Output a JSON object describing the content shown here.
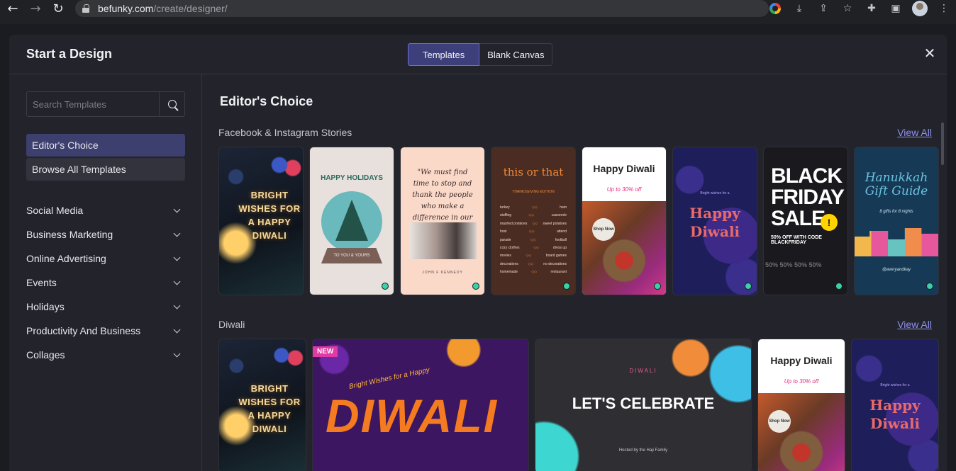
{
  "browser": {
    "url_host": "befunky.com",
    "url_path": "/create/designer/",
    "icons": [
      "back-arrow-icon",
      "forward-arrow-icon",
      "reload-icon",
      "lock-icon",
      "google-icon",
      "download-icon",
      "share-icon",
      "star-icon",
      "extensions-icon",
      "sidebar-icon",
      "profile-avatar",
      "menu-icon"
    ]
  },
  "modal": {
    "title": "Start a Design",
    "tabs": [
      "Templates",
      "Blank Canvas"
    ],
    "active_tab": "Templates",
    "accent": "#3d3f7a"
  },
  "sidebar": {
    "search_placeholder": "Search Templates",
    "primary": [
      {
        "label": "Editor's Choice",
        "selected": true
      },
      {
        "label": "Browse All Templates",
        "selected": false
      }
    ],
    "categories": [
      "Social Media",
      "Business Marketing",
      "Online Advertising",
      "Events",
      "Holidays",
      "Productivity And Business",
      "Collages"
    ]
  },
  "main": {
    "title": "Editor's Choice",
    "view_all": "View All",
    "sections": [
      {
        "label": "Facebook & Instagram Stories",
        "templates": [
          {
            "name": "bright-wishes-diwali",
            "text": "BRIGHT WISHES FOR A HAPPY DIWALI"
          },
          {
            "name": "happy-holidays",
            "text": "HAPPY HOLIDAYS",
            "sub": "TO YOU & YOURS",
            "premium": true
          },
          {
            "name": "kennedy-quote",
            "text": "\"We must find time to stop and thank the people who make a difference in our lives.\"",
            "sub": "JOHN F KENNEDY",
            "premium": true
          },
          {
            "name": "this-or-that",
            "text": "this or that",
            "sub": "THANKSGIVING EDITION",
            "rows": [
              [
                "turkey",
                "ham"
              ],
              [
                "stuffing",
                "casserole"
              ],
              [
                "mashed potatoes",
                "sweet potatoes"
              ],
              [
                "host",
                "attend"
              ],
              [
                "parade",
                "football"
              ],
              [
                "cozy clothes",
                "dress up"
              ],
              [
                "movies",
                "board games"
              ],
              [
                "decorations",
                "no decorations"
              ],
              [
                "homemade",
                "restaurant"
              ]
            ],
            "premium": true
          },
          {
            "name": "happy-diwali-sale",
            "text": "Happy Diwali",
            "sub": "Up to 30% off",
            "badge": "Shop Now",
            "premium": true
          },
          {
            "name": "happy-diwali-purple",
            "text": "Happy Diwali",
            "sub": "Bright wishes for a",
            "premium": true
          },
          {
            "name": "black-friday-sale",
            "text": "BLACK FRIDAY SALE",
            "sub": "50% OFF WITH CODE BLACKFRIDAY",
            "repeat": "50% 50% 50% 50%",
            "premium": true
          },
          {
            "name": "hanukkah-gift-guide",
            "text": "Hanukkah Gift Guide",
            "sub": "8 gifts for 8 nights",
            "tag": "@averyandkay",
            "premium": true
          }
        ]
      },
      {
        "label": "Diwali",
        "templates": [
          {
            "name": "bright-wishes-diwali-2",
            "text": "BRIGHT WISHES FOR A HAPPY DIWALI"
          },
          {
            "name": "diwali-banner",
            "badge": "NEW",
            "sub": "Bright Wishes for a Happy",
            "text": "DIWALI"
          },
          {
            "name": "lets-celebrate",
            "sub": "DIWALI",
            "text": "LET'S CELEBRATE",
            "tag": "Hosted by the Haji Family"
          },
          {
            "name": "happy-diwali-sale-2",
            "text": "Happy Diwali",
            "sub": "Up to 30% off",
            "badge": "Shop Now"
          },
          {
            "name": "happy-diwali-purple-2",
            "text": "Happy Diwali",
            "sub": "Bright wishes for a"
          }
        ]
      }
    ]
  }
}
